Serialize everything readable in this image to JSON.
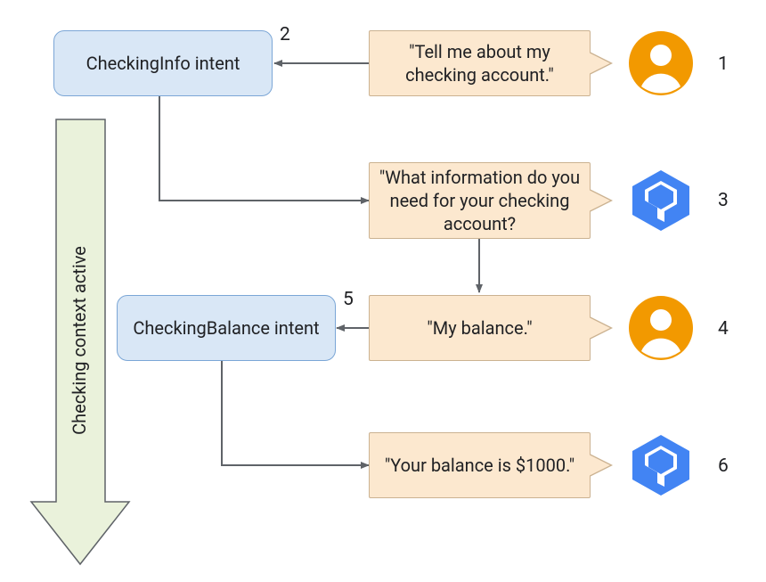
{
  "diagram": {
    "intent1": "CheckingInfo intent",
    "intent2": "CheckingBalance intent",
    "utterance1": "\"Tell me about my checking account.\"",
    "response1": "\"What information do you need for your checking account?",
    "utterance2": "\"My balance.\"",
    "response2": "\"Your balance is $1000.\"",
    "context_label": "Checking context active",
    "step1": "1",
    "step2": "2",
    "step3": "3",
    "step4": "4",
    "step5": "5",
    "step6": "6"
  },
  "icons": {
    "user": "user-avatar-icon",
    "agent": "dialogflow-agent-icon"
  },
  "colors": {
    "intent_bg": "#d9e7f6",
    "intent_border": "#7ba6d6",
    "speech_bg": "#fce8cf",
    "speech_border": "#CBB291",
    "user_icon": "#f29900",
    "agent_icon": "#4284f3",
    "arrow": "#5f6368",
    "context_arrow_fill": "#eaf2db",
    "context_arrow_border": "#5f6368"
  }
}
